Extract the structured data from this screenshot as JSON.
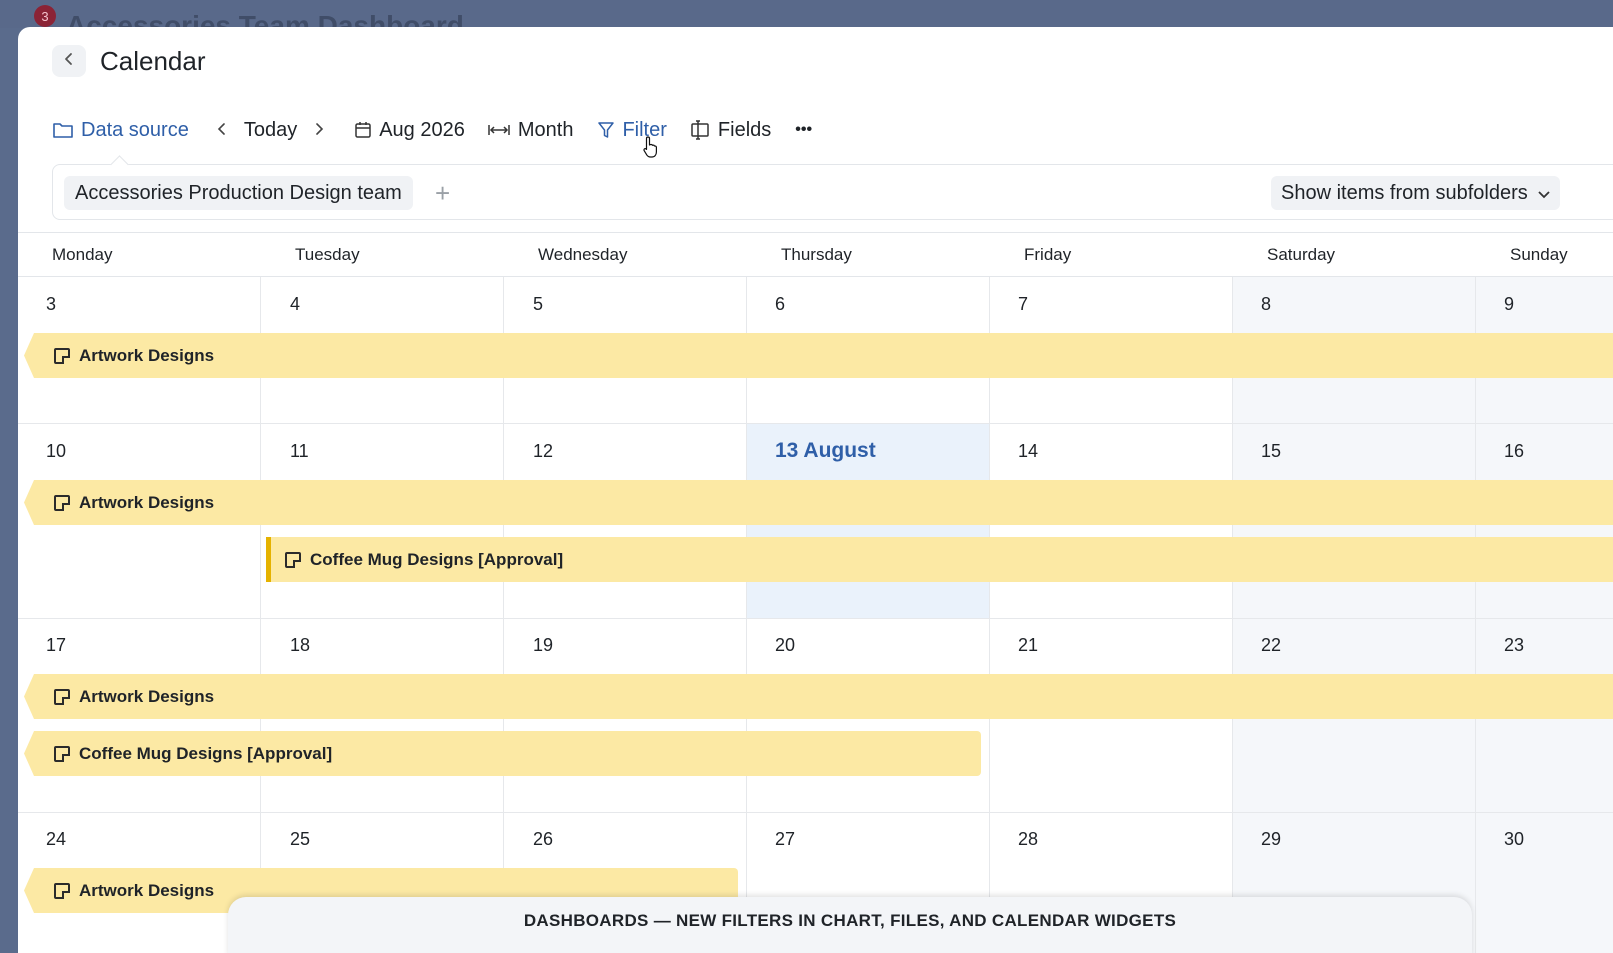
{
  "background": {
    "badge_count": "3",
    "title": "Accessories Team Dashboard"
  },
  "header": {
    "title": "Calendar",
    "back_icon": "chevron-left-icon"
  },
  "toolbar": {
    "data_source": "Data source",
    "today": "Today",
    "date": "Aug 2026",
    "view": "Month",
    "filter": "Filter",
    "fields": "Fields",
    "more": "•••"
  },
  "filter_panel": {
    "chip": "Accessories Production Design team",
    "add": "+",
    "subfolders": "Show items from subfolders"
  },
  "days": [
    "Monday",
    "Tuesday",
    "Wednesday",
    "Thursday",
    "Friday",
    "Saturday",
    "Sunday"
  ],
  "weeks": [
    [
      "3",
      "4",
      "5",
      "6",
      "7",
      "8",
      "9"
    ],
    [
      "10",
      "11",
      "12",
      "13 August",
      "14",
      "15",
      "16"
    ],
    [
      "17",
      "18",
      "19",
      "20",
      "21",
      "22",
      "23"
    ],
    [
      "24",
      "25",
      "26",
      "27",
      "28",
      "29",
      "30"
    ]
  ],
  "events": {
    "w1_artwork": "Artwork Designs",
    "w2_artwork": "Artwork Designs",
    "w2_coffee": "Coffee Mug Designs [Approval]",
    "w3_artwork": "Artwork Designs",
    "w3_coffee": "Coffee Mug Designs [Approval]",
    "w4_artwork": "Artwork Designs"
  },
  "banner": "DASHBOARDS — NEW FILTERS IN CHART, FILES, AND CALENDAR WIDGETS",
  "colors": {
    "accent": "#2f5fa8",
    "event": "#fce9a4",
    "today_bg": "#eaf2fb",
    "weekend_bg": "#f5f7fa"
  }
}
